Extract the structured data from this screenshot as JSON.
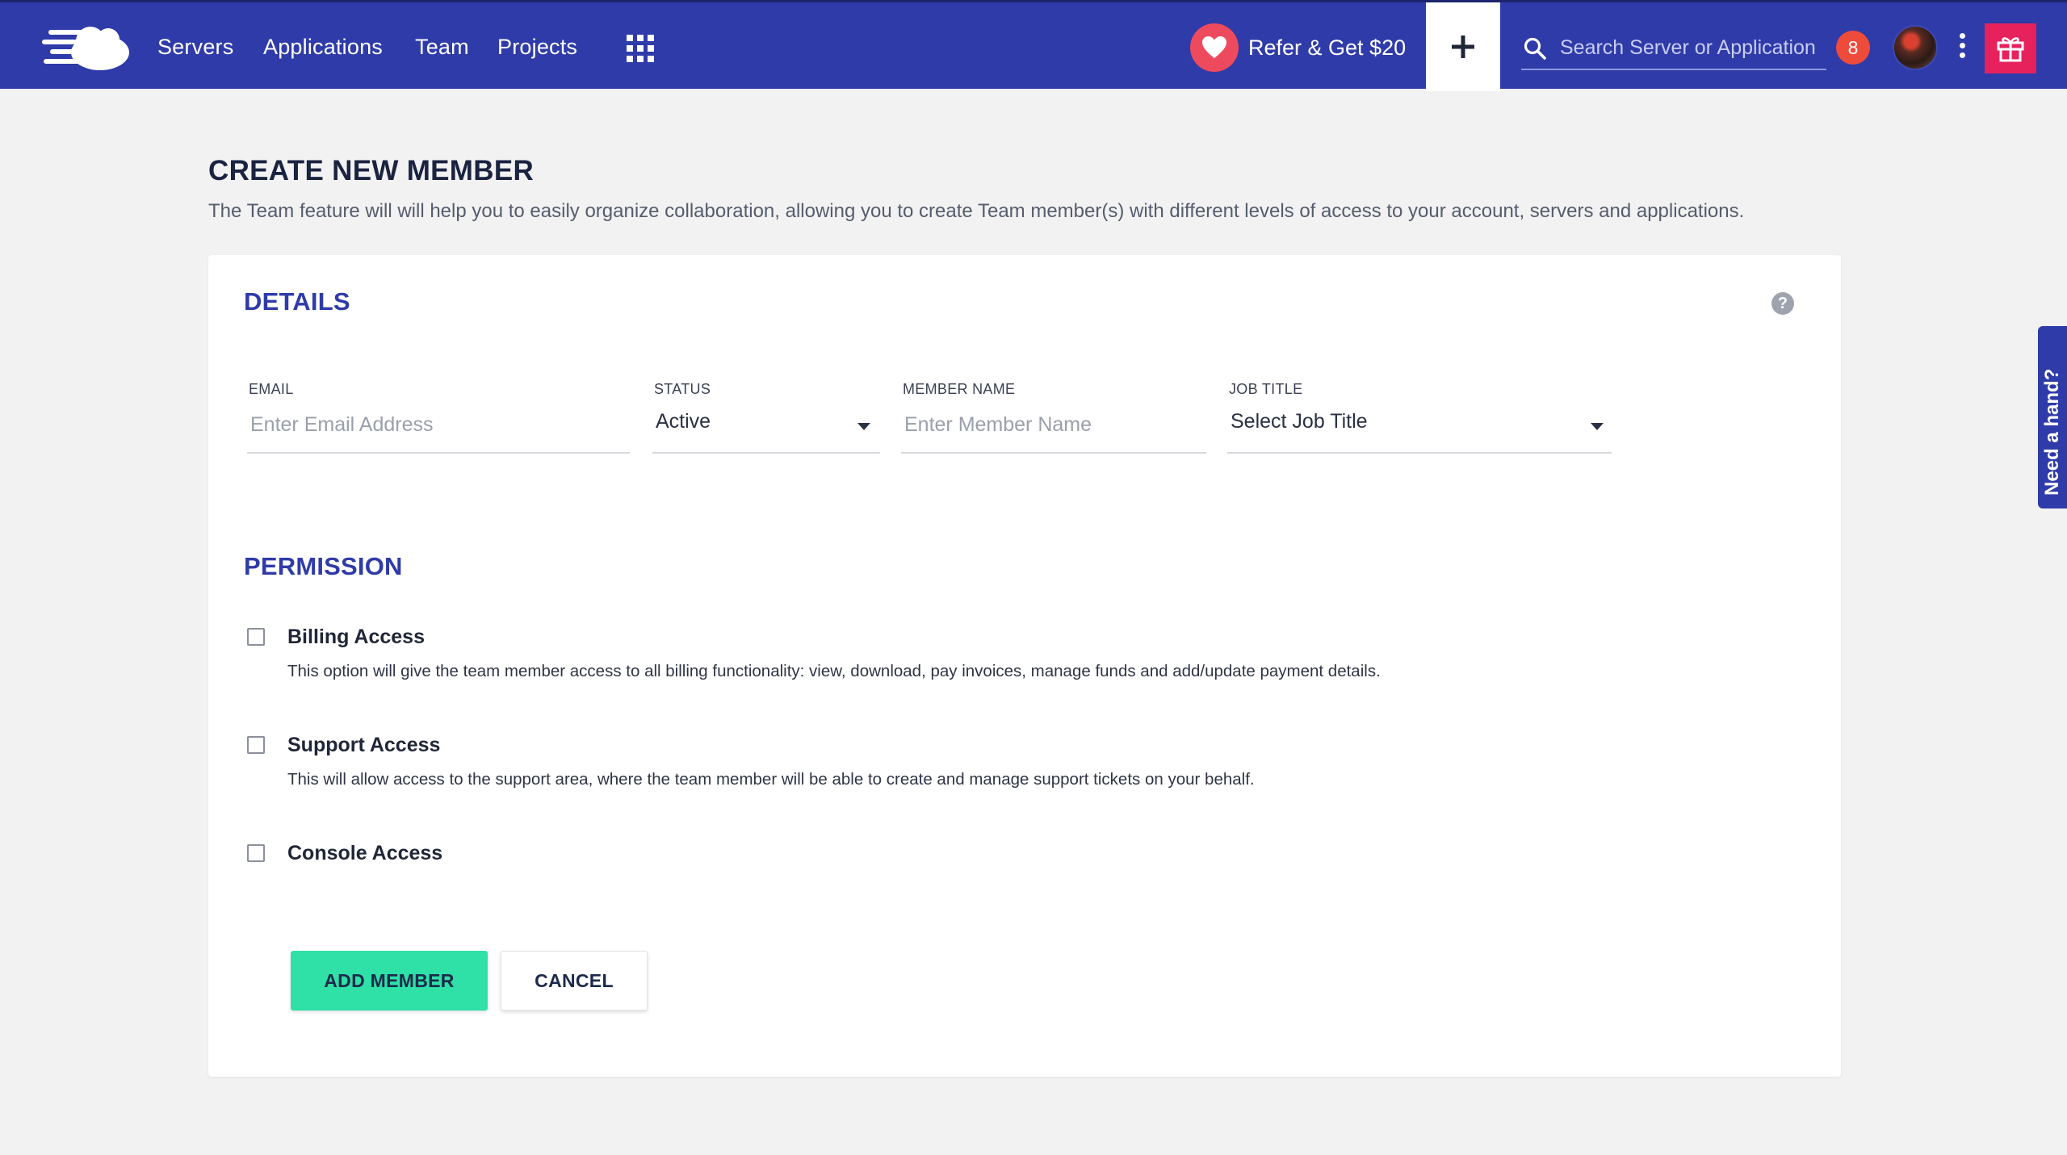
{
  "nav": {
    "logo_icon": "cloud-logo-icon",
    "items": [
      {
        "label": "Servers"
      },
      {
        "label": "Applications"
      },
      {
        "label": "Team"
      },
      {
        "label": "Projects"
      }
    ],
    "apps_icon": "grid-icon",
    "refer_label": "Refer & Get $20",
    "refer_icon": "heart-icon",
    "add_icon": "plus-icon",
    "search_placeholder": "Search Server or Application",
    "search_icon": "search-icon",
    "notification_count": "8",
    "more_icon": "kebab-icon",
    "gift_icon": "gift-icon"
  },
  "page": {
    "title": "CREATE NEW MEMBER",
    "description": "The Team feature will will help you to easily organize collaboration, allowing you to create Team member(s) with different levels of access to your account, servers and applications."
  },
  "details": {
    "title": "DETAILS",
    "help_icon": "?",
    "email": {
      "label": "EMAIL",
      "placeholder": "Enter Email Address"
    },
    "status": {
      "label": "STATUS",
      "value": "Active"
    },
    "member_name": {
      "label": "MEMBER NAME",
      "placeholder": "Enter Member Name"
    },
    "job_title": {
      "label": "JOB TITLE",
      "value": "Select Job Title"
    }
  },
  "permission": {
    "title": "PERMISSION",
    "items": [
      {
        "title": "Billing Access",
        "description": "This option will give the team member access to all billing functionality: view, download, pay invoices, manage funds and add/update payment details."
      },
      {
        "title": "Support Access",
        "description": "This will allow access to the support area, where the team member will be able to create and manage support tickets on your behalf."
      },
      {
        "title": "Console Access",
        "description": ""
      }
    ]
  },
  "actions": {
    "add_label": "ADD MEMBER",
    "cancel_label": "CANCEL"
  },
  "side_help": {
    "label": "Need a hand?"
  },
  "colors": {
    "nav_bg": "#2f3ba8",
    "accent_green": "#2fe0a7",
    "badge_red": "#ef4b3b",
    "gift_pink": "#e6215c",
    "heart_red": "#ee4a5d"
  }
}
